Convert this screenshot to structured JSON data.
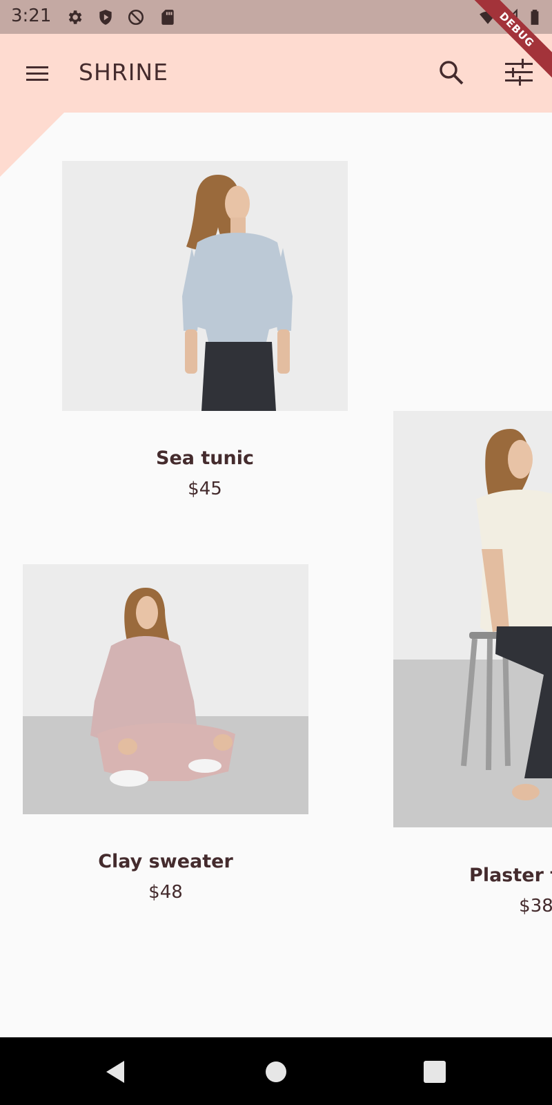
{
  "status_bar": {
    "time": "3:21",
    "icons": [
      "settings-icon",
      "shield-icon",
      "sync-disabled-icon",
      "sd-card-icon",
      "wifi-icon",
      "signal-icon",
      "battery-icon"
    ]
  },
  "app_bar": {
    "title": "SHRINE",
    "debug_label": "DEBUG",
    "background": "#fedbd0"
  },
  "products": [
    {
      "name": "Sea tunic",
      "price": "$45"
    },
    {
      "name": "Clay sweater",
      "price": "$48"
    },
    {
      "name": "Plaster tunic",
      "price": "$38"
    }
  ],
  "colors": {
    "text": "#442b2d",
    "accent": "#fedbd0",
    "debug": "#a3333a"
  }
}
